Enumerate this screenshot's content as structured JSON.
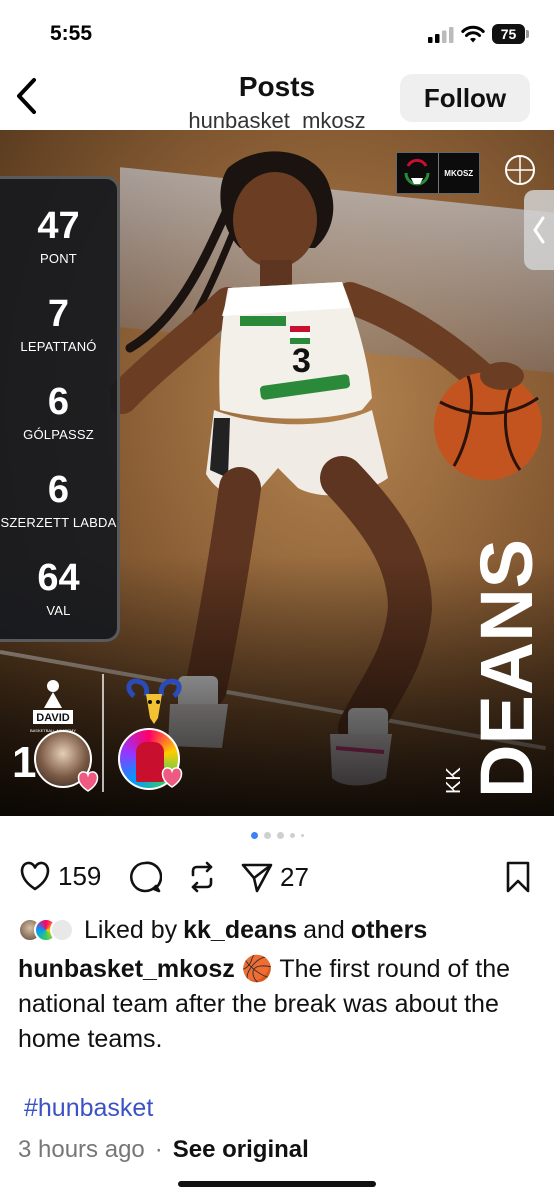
{
  "status_bar": {
    "time": "5:55",
    "battery": "75",
    "icons": [
      "signal-icon",
      "wifi-icon",
      "battery-icon"
    ]
  },
  "header": {
    "title": "Posts",
    "username": "hunbasket_mkosz",
    "follow_label": "Follow",
    "back_icon": "chevron-left-icon"
  },
  "post_image": {
    "stats": [
      {
        "value": "47",
        "label": "PONT"
      },
      {
        "value": "7",
        "label": "LEPATTANÓ"
      },
      {
        "value": "6",
        "label": "GÓLPASSZ"
      },
      {
        "value": "6",
        "label": "SZERZETT LABDA"
      },
      {
        "value": "64",
        "label": "VAL"
      }
    ],
    "player_first_name": "KK",
    "player_last_name": "DEANS",
    "jersey_number": "1",
    "logo_mkosz": "MKOSZ",
    "sponsor_david": "DAVID",
    "sponsor_david_sub": "BASKETBALL ACADEMY"
  },
  "carousel": {
    "count": 5,
    "active_index": 0
  },
  "actions": {
    "likes_count": "159",
    "shares_count": "27",
    "icons": [
      "heart-icon",
      "comment-icon",
      "repost-icon",
      "send-icon",
      "bookmark-icon"
    ]
  },
  "likes": {
    "prefix": "Liked by",
    "user": "kk_deans",
    "connector": "and",
    "others": "others"
  },
  "caption": {
    "user": "hunbasket_mkosz",
    "emoji": "🏀",
    "text": "The first round of the national team after the break was about the home teams."
  },
  "hashtag": "#hunbasket",
  "meta": {
    "time_ago": "3 hours ago",
    "separator": "·",
    "see_original": "See original"
  },
  "colors": {
    "accent_blue": "#3b82f6",
    "hashtag": "#3b52c4",
    "follow_bg": "#efefef"
  }
}
